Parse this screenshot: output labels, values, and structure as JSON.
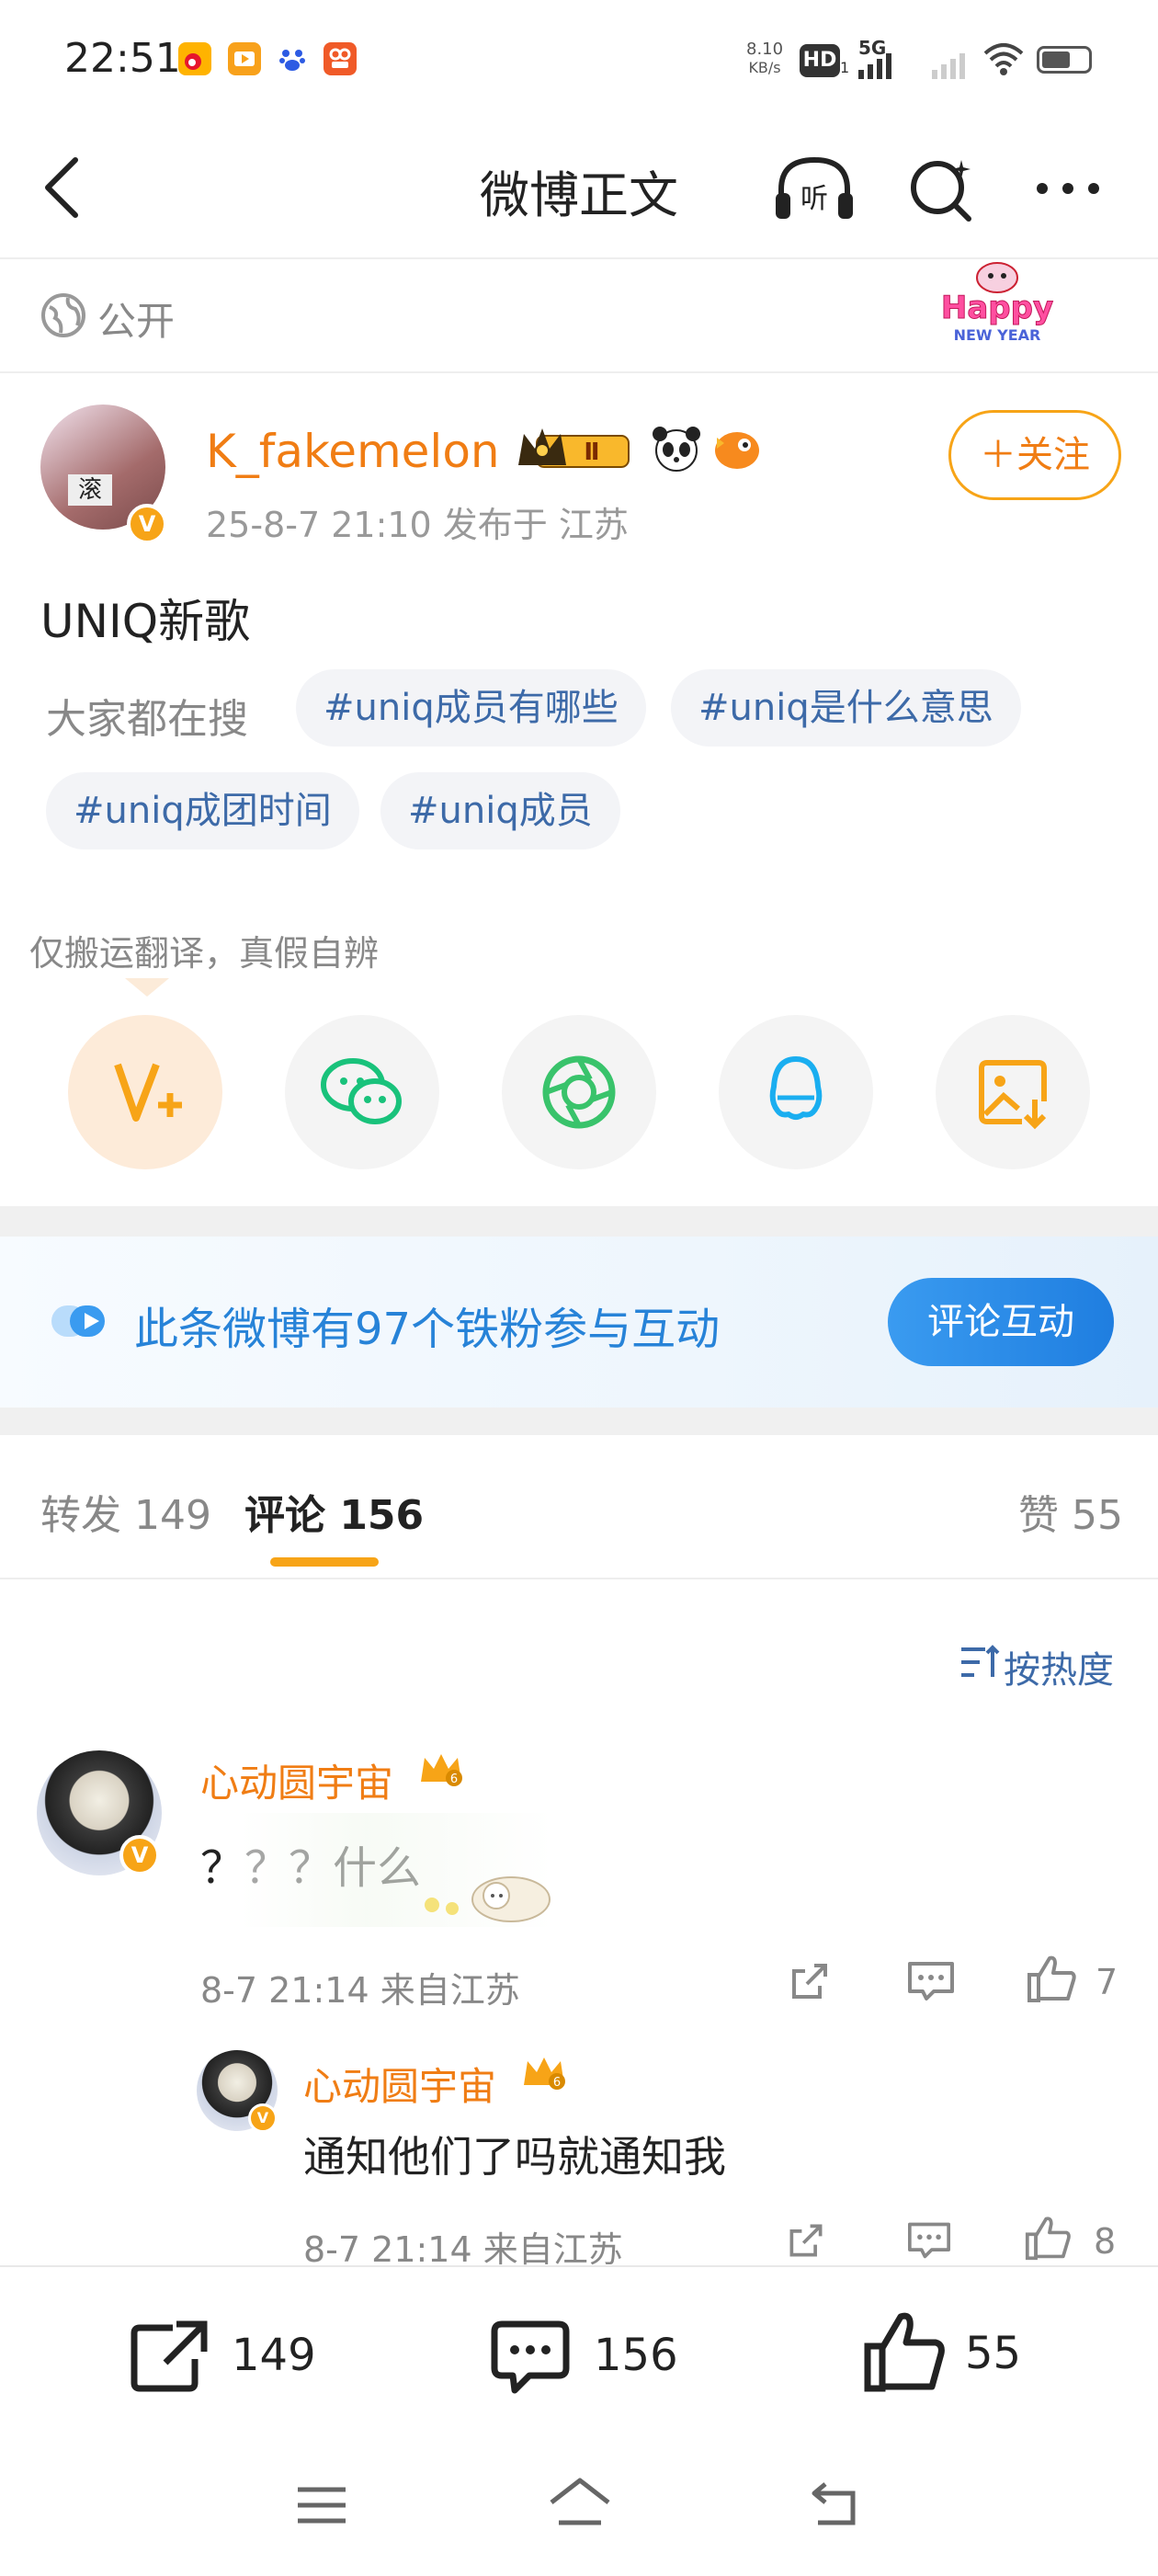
{
  "status_bar": {
    "time": "22:51",
    "net_speed_value": "8.10",
    "net_speed_unit": "KB/s",
    "hd_label": "HD",
    "sim_index": "1",
    "network": "5G"
  },
  "header": {
    "title": "微博正文"
  },
  "visibility": {
    "label": "公开",
    "decoration_text": "Happy NEW YEAR"
  },
  "post": {
    "author": {
      "name": "K_fakemelon",
      "avatar_badge": "滚",
      "vip_level": "Ⅱ"
    },
    "meta": "25-8-7 21:10   发布于 江苏",
    "follow_label": "＋关注",
    "text": "UNIQ新歌",
    "search_label": "大家都在搜",
    "topics": [
      "#uniq成员有哪些",
      "#uniq是什么意思",
      "#uniq成团时间",
      "#uniq成员"
    ]
  },
  "share": {
    "hint": "仅搬运翻译，真假自辨",
    "targets": [
      {
        "icon": "weibo-repost-icon",
        "color": "#f7a417"
      },
      {
        "icon": "wechat-icon",
        "color": "#19c27b"
      },
      {
        "icon": "moments-icon",
        "color": "#39c36b"
      },
      {
        "icon": "qq-icon",
        "color": "#1aaef0"
      },
      {
        "icon": "save-image-icon",
        "color": "#f7a417"
      }
    ]
  },
  "banner": {
    "text": "此条微博有97个铁粉参与互动",
    "button": "评论互动"
  },
  "tabs": {
    "repost": "转发 149",
    "comments": "评论 156",
    "likes": "赞 55"
  },
  "sort_label": "按热度",
  "comments": [
    {
      "user": "心动圆宇宙",
      "text": "？？？什么",
      "meta": "8-7 21:14  来自江苏",
      "likes": "7",
      "replies": [
        {
          "user": "心动圆宇宙",
          "text": "通知他们了吗就通知我",
          "meta": "8-7 21:14  来自江苏",
          "likes": "8"
        }
      ]
    }
  ],
  "bottom_bar": {
    "repost_count": "149",
    "comment_count": "156",
    "like_count": "55"
  },
  "colors": {
    "accent": "#f07d14",
    "link": "#3d6aa8",
    "banner_blue": "#2783d8"
  }
}
